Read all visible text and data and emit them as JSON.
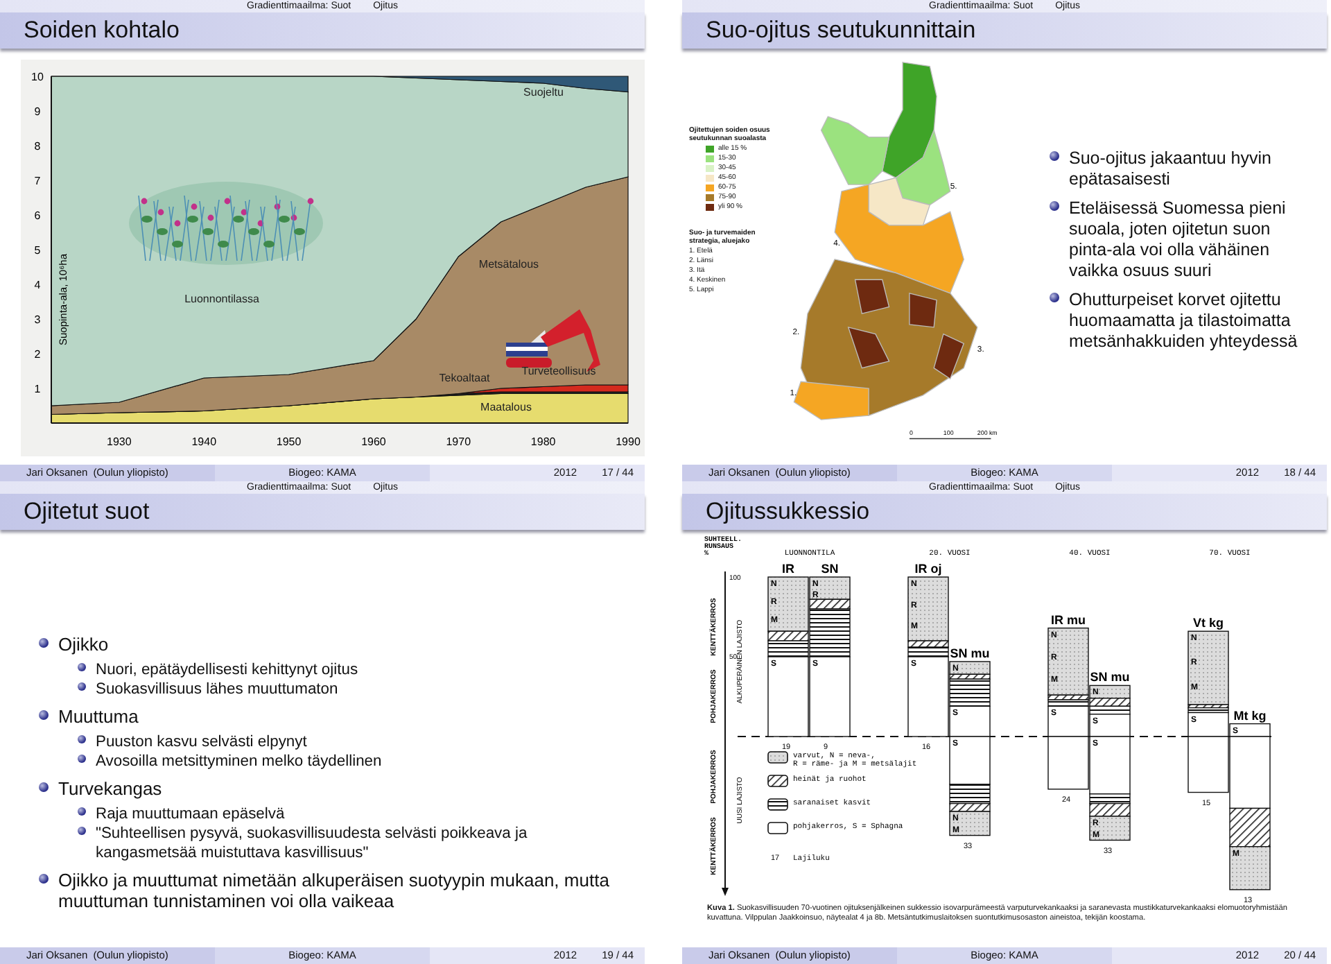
{
  "slides": [
    {
      "kind": "area_figure",
      "nav": {
        "section": "Gradienttimaailma: Suot",
        "subsection": "Ojitus"
      },
      "title": "Soiden kohtalo",
      "footer": {
        "author": "Jari Oksanen",
        "institute": "(Oulun yliopisto)",
        "short_title": "Biogeo: KAMA",
        "date": "2012",
        "page": "17 / 44"
      },
      "chart_data": {
        "type": "area",
        "stacked": true,
        "ylabel": "Suopinta-ala, 10⁶ha",
        "x": [
          1922,
          1930,
          1940,
          1950,
          1960,
          1965,
          1970,
          1975,
          1980,
          1985,
          1990
        ],
        "xlim": [
          1922,
          1990
        ],
        "ylim": [
          0,
          10
        ],
        "xticks": [
          1930,
          1940,
          1950,
          1960,
          1970,
          1980,
          1990
        ],
        "yticks": [
          1,
          2,
          3,
          4,
          5,
          6,
          7,
          8,
          9,
          10
        ],
        "series": [
          {
            "name": "Maatalous",
            "color": "#e6dc6e",
            "values": [
              0.25,
              0.3,
              0.35,
              0.5,
              0.7,
              0.75,
              0.8,
              0.85,
              0.85,
              0.85,
              0.85
            ]
          },
          {
            "name": "Tekoaltaat",
            "color": "#222222",
            "values": [
              0,
              0,
              0,
              0,
              0,
              0,
              0.05,
              0.05,
              0.05,
              0.05,
              0.05
            ]
          },
          {
            "name": "Turveteollisuus",
            "color": "#d42a1e",
            "values": [
              0,
              0,
              0,
              0,
              0,
              0,
              0,
              0.1,
              0.15,
              0.2,
              0.2
            ]
          },
          {
            "name": "Metsätalous",
            "color": "#a88a66",
            "values": [
              0.25,
              0.3,
              0.95,
              0.9,
              1.1,
              2.25,
              3.95,
              4.8,
              5.25,
              5.7,
              6.0
            ]
          },
          {
            "name": "Luonnontilassa",
            "color": "#b8d6c6",
            "values": [
              9.5,
              9.4,
              8.7,
              8.6,
              8.2,
              6.95,
              5.1,
              4.05,
              3.5,
              2.85,
              2.45
            ]
          },
          {
            "name": "Suojeltu",
            "color": "#2f5877",
            "values": [
              0,
              0,
              0,
              0,
              0,
              0.05,
              0.1,
              0.15,
              0.2,
              0.35,
              0.45
            ]
          }
        ]
      }
    },
    {
      "kind": "map_bullets",
      "nav": {
        "section": "Gradienttimaailma: Suot",
        "subsection": "Ojitus"
      },
      "title": "Suo-ojitus seutukunnittain",
      "footer": {
        "author": "Jari Oksanen",
        "institute": "(Oulun yliopisto)",
        "short_title": "Biogeo: KAMA",
        "date": "2012",
        "page": "18 / 44"
      },
      "map": {
        "legend_title": "Ojitettujen soiden osuus seutukunnan suoalasta",
        "legend": [
          {
            "label": "alle 15 %",
            "color": "#3fa428"
          },
          {
            "label": "15-30",
            "color": "#9be27f"
          },
          {
            "label": "30-45",
            "color": "#d9f2c6"
          },
          {
            "label": "45-60",
            "color": "#f6e7c6"
          },
          {
            "label": "60-75",
            "color": "#f5a623"
          },
          {
            "label": "75-90",
            "color": "#a67a2a"
          },
          {
            "label": "yli 90 %",
            "color": "#6e2a10"
          }
        ],
        "regions_title": "Suo- ja turvemaiden strategia, aluejako",
        "regions": [
          "1. Etelä",
          "2. Länsi",
          "3. Itä",
          "4. Keskinen",
          "5. Lappi"
        ],
        "area_numbers": [
          "1.",
          "2.",
          "3.",
          "4.",
          "5."
        ],
        "scale": [
          "0",
          "100",
          "200 km"
        ]
      },
      "bullets": [
        {
          "text": "Suo-ojitus jakaantuu hyvin epätasaisesti"
        },
        {
          "text": "Eteläisessä Suomessa pieni suoala, joten ojitetun suon pinta-ala voi olla vähäinen vaikka osuus suuri"
        },
        {
          "text": "Ohutturpeiset korvet ojitettu huomaamatta ja tilastoimatta metsänhakkuiden yhteydessä"
        }
      ]
    },
    {
      "kind": "bullets",
      "nav": {
        "section": "Gradienttimaailma: Suot",
        "subsection": "Ojitus"
      },
      "title": "Ojitetut suot",
      "footer": {
        "author": "Jari Oksanen",
        "institute": "(Oulun yliopisto)",
        "short_title": "Biogeo: KAMA",
        "date": "2012",
        "page": "19 / 44"
      },
      "bullets": [
        {
          "text": "Ojikko",
          "children": [
            {
              "text": "Nuori, epätäydellisesti kehittynyt ojitus"
            },
            {
              "text": "Suokasvillisuus lähes muuttumaton"
            }
          ]
        },
        {
          "text": "Muuttuma",
          "children": [
            {
              "text": "Puuston kasvu selvästi elpynyt"
            },
            {
              "text": "Avosoilla metsittyminen melko täydellinen"
            }
          ]
        },
        {
          "text": "Turvekangas",
          "children": [
            {
              "text": "Raja muuttumaan epäselvä"
            },
            {
              "text": "\"Suhteellisen pysyvä, suokasvillisuudesta selvästi poikkeava ja kangasmetsää muistuttava kasvillisuus\""
            }
          ]
        },
        {
          "text": "Ojikko ja muuttumat nimetään alkuperäisen suotyypin mukaan, mutta muuttuman tunnistaminen voi olla vaikeaa"
        }
      ]
    },
    {
      "kind": "succession_figure",
      "nav": {
        "section": "Gradienttimaailma: Suot",
        "subsection": "Ojitus"
      },
      "title": "Ojitussukkessio",
      "footer": {
        "author": "Jari Oksanen",
        "institute": "(Oulun yliopisto)",
        "short_title": "Biogeo: KAMA",
        "date": "2012",
        "page": "20 / 44"
      },
      "figure": {
        "axis_title": [
          "SUHTEELL.",
          "RUNSAUS",
          "%"
        ],
        "yticks": [
          "100",
          "50"
        ],
        "upper_labels": [
          "KENTTÄKERROS",
          "POHJAKERROS"
        ],
        "upper_species": "ALKUPERÄINEN LAJISTO",
        "lower_labels": [
          "POHJAKERROS",
          "KENTTÄKERROS"
        ],
        "lower_species": "UUSI LAJISTO",
        "groups": [
          {
            "title": "LUONNONTILA",
            "columns": [
              {
                "label": "IR",
                "count": "19",
                "above": [
                  {
                    "kind": "dwarf",
                    "letters": [
                      "N",
                      "R",
                      "M"
                    ]
                  },
                  {
                    "kind": "herb"
                  },
                  {
                    "kind": "sedge"
                  },
                  {
                    "kind": "moss",
                    "letters": [
                      "S"
                    ]
                  }
                ]
              },
              {
                "label": "SN",
                "count": "9",
                "above": [
                  {
                    "kind": "dwarf",
                    "letters": [
                      "N",
                      "R"
                    ]
                  },
                  {
                    "kind": "herb"
                  },
                  {
                    "kind": "sedge"
                  },
                  {
                    "kind": "moss",
                    "letters": [
                      "S"
                    ]
                  }
                ]
              }
            ]
          },
          {
            "title": "20. VUOSI",
            "columns": [
              {
                "label": "IR oj",
                "count": "16",
                "above": [
                  {
                    "kind": "dwarf",
                    "letters": [
                      "N",
                      "R",
                      "M"
                    ]
                  },
                  {
                    "kind": "herb"
                  },
                  {
                    "kind": "sedge"
                  },
                  {
                    "kind": "moss",
                    "letters": [
                      "S"
                    ]
                  }
                ]
              },
              {
                "label": "SN mu",
                "count": "33",
                "above": [
                  {
                    "kind": "dwarf",
                    "letters": [
                      "N"
                    ]
                  },
                  {
                    "kind": "herb"
                  },
                  {
                    "kind": "sedge"
                  },
                  {
                    "kind": "moss",
                    "letters": [
                      "S"
                    ]
                  }
                ],
                "below": [
                  {
                    "kind": "moss",
                    "letters": [
                      "S"
                    ]
                  },
                  {
                    "kind": "sedge"
                  },
                  {
                    "kind": "herb"
                  },
                  {
                    "kind": "dwarf",
                    "letters": [
                      "N",
                      "M"
                    ]
                  }
                ]
              }
            ]
          },
          {
            "title": "40. VUOSI",
            "columns": [
              {
                "label": "IR mu",
                "count": "24",
                "above": [
                  {
                    "kind": "dwarf",
                    "letters": [
                      "N",
                      "R",
                      "M"
                    ]
                  },
                  {
                    "kind": "herb"
                  },
                  {
                    "kind": "sedge"
                  },
                  {
                    "kind": "moss",
                    "letters": [
                      "S"
                    ]
                  }
                ],
                "below": [
                  {
                    "kind": "moss"
                  }
                ]
              },
              {
                "label": "SN mu",
                "count": "33",
                "above": [
                  {
                    "kind": "dwarf",
                    "letters": [
                      "N"
                    ]
                  },
                  {
                    "kind": "herb"
                  },
                  {
                    "kind": "sedge"
                  },
                  {
                    "kind": "moss",
                    "letters": [
                      "S"
                    ]
                  }
                ],
                "below": [
                  {
                    "kind": "moss",
                    "letters": [
                      "S"
                    ]
                  },
                  {
                    "kind": "sedge"
                  },
                  {
                    "kind": "herb"
                  },
                  {
                    "kind": "dwarf",
                    "letters": [
                      "R",
                      "M"
                    ]
                  }
                ]
              }
            ]
          },
          {
            "title": "70. VUOSI",
            "columns": [
              {
                "label": "Vt kg",
                "count": "15",
                "above": [
                  {
                    "kind": "dwarf",
                    "letters": [
                      "N",
                      "R",
                      "M"
                    ]
                  },
                  {
                    "kind": "herb"
                  },
                  {
                    "kind": "sedge"
                  },
                  {
                    "kind": "moss",
                    "letters": [
                      "S"
                    ]
                  }
                ],
                "below": [
                  {
                    "kind": "moss"
                  }
                ]
              },
              {
                "label": "Mt kg",
                "count": "13",
                "above": [
                  {
                    "kind": "moss",
                    "letters": [
                      "S"
                    ]
                  }
                ],
                "below": [
                  {
                    "kind": "moss"
                  },
                  {
                    "kind": "herb"
                  },
                  {
                    "kind": "dwarf",
                    "letters": [
                      "M"
                    ]
                  }
                ]
              }
            ]
          }
        ],
        "legend": [
          {
            "kind": "dwarf",
            "lines": [
              "varvut, N = neva-,",
              "R = räme- ja M = metsälajit"
            ]
          },
          {
            "kind": "herb",
            "lines": [
              "heinät ja ruohot"
            ]
          },
          {
            "kind": "sedge",
            "lines": [
              "saranaiset kasvit"
            ]
          },
          {
            "kind": "moss",
            "lines": [
              "pohjakerros, S = Sphagna"
            ]
          }
        ],
        "count_legend": {
          "number": "17",
          "text": "Lajiluku"
        },
        "caption": "**Kuva 1.** Suokasvillisuuden 70-vuotinen ojituksenjälkeinen sukkessio isovarpurämeestä varputurvekankaaksi ja saranevasta mustikkaturvekankaaksi elomuotoryhmistään kuvattuna. Vilppulan Jaakkoinsuo, näytealat 4 ja 8b. Metsäntutkimuslaitoksen suontutkimusosaston aineistoa, tekijän koostama."
      }
    }
  ]
}
